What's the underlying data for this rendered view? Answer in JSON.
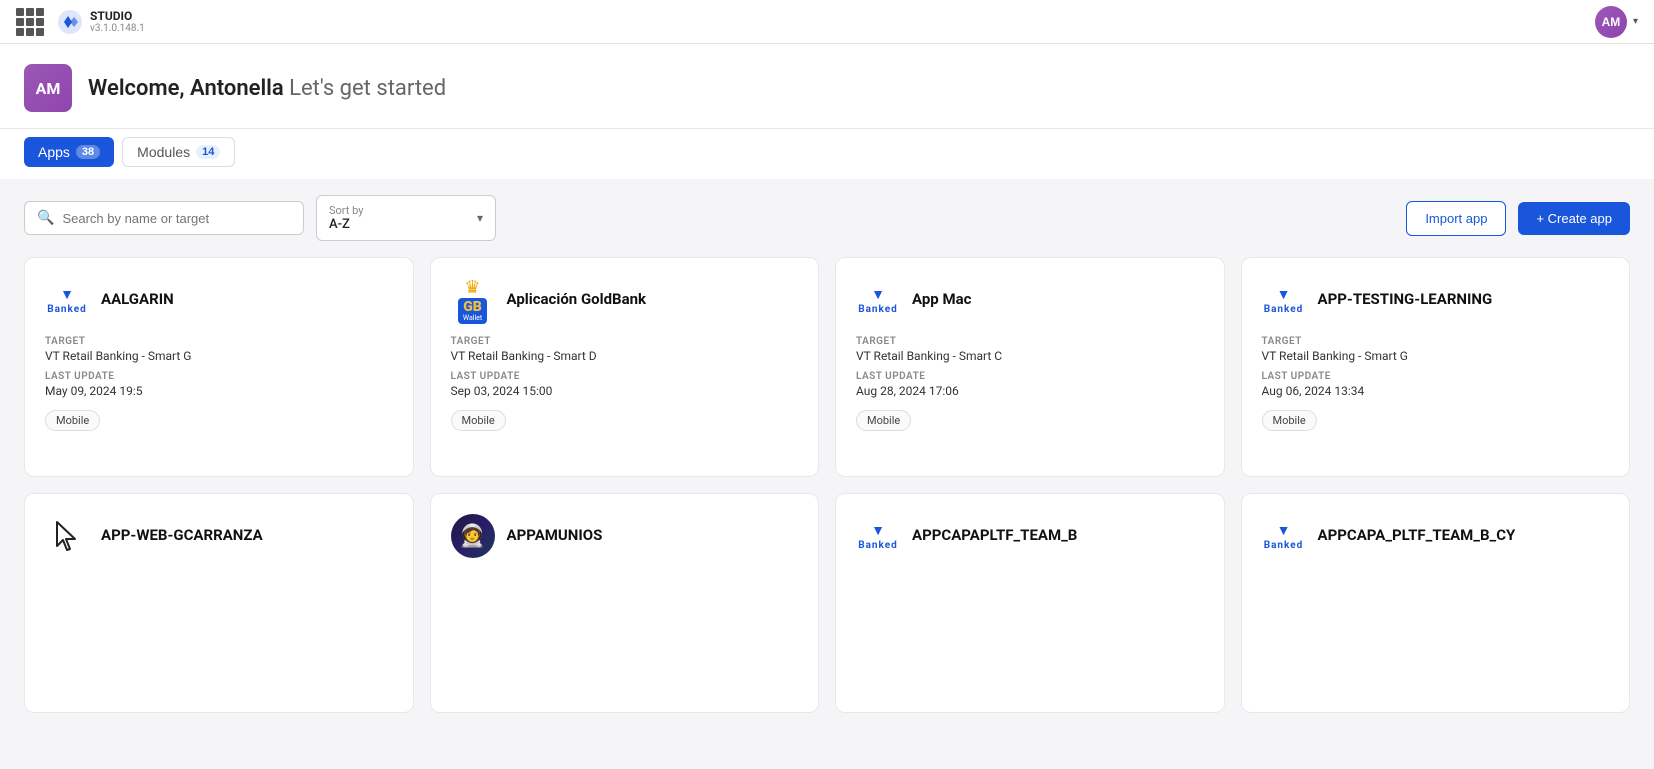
{
  "topNav": {
    "logo": "STUDIO",
    "version": "v3.1.0.148.1",
    "userInitials": "AM"
  },
  "welcome": {
    "userInitials": "AM",
    "greeting": "Welcome, Antonella",
    "subtitle": "Let's get started"
  },
  "tabs": [
    {
      "id": "apps",
      "label": "Apps",
      "count": "38",
      "active": true
    },
    {
      "id": "modules",
      "label": "Modules",
      "count": "14",
      "active": false
    }
  ],
  "toolbar": {
    "searchPlaceholder": "Search by name or target",
    "sortLabel": "Sort by",
    "sortValue": "A-Z",
    "importLabel": "Import app",
    "createLabel": "+ Create app"
  },
  "apps": [
    {
      "id": "aalgarin",
      "name": "AALGARIN",
      "logoType": "banked",
      "target": "VT Retail Banking - Smart G",
      "lastUpdate": "May 09, 2024 19:5",
      "tag": "Mobile"
    },
    {
      "id": "goldbank",
      "name": "Aplicación GoldBank",
      "logoType": "gb",
      "target": "VT Retail Banking - Smart D",
      "lastUpdate": "Sep 03, 2024 15:00",
      "tag": "Mobile"
    },
    {
      "id": "appmac",
      "name": "App Mac",
      "logoType": "banked",
      "target": "VT Retail Banking - Smart C",
      "lastUpdate": "Aug 28, 2024 17:06",
      "tag": "Mobile"
    },
    {
      "id": "apptesting",
      "name": "APP-TESTING-LEARNING",
      "logoType": "banked",
      "target": "VT Retail Banking - Smart G",
      "lastUpdate": "Aug 06, 2024 13:34",
      "tag": "Mobile"
    },
    {
      "id": "appweb",
      "name": "APP-WEB-GCARRANZA",
      "logoType": "cursor",
      "target": "",
      "lastUpdate": "",
      "tag": ""
    },
    {
      "id": "appamunios",
      "name": "APPAMUNIOS",
      "logoType": "astro",
      "target": "",
      "lastUpdate": "",
      "tag": ""
    },
    {
      "id": "appcapapltf",
      "name": "APPCAPAPLTF_TEAM_B",
      "logoType": "banked",
      "target": "",
      "lastUpdate": "",
      "tag": ""
    },
    {
      "id": "appcapapltfcy",
      "name": "APPCAPA_PLTF_TEAM_B_CY",
      "logoType": "banked",
      "target": "",
      "lastUpdate": "",
      "tag": ""
    }
  ],
  "fieldLabels": {
    "target": "TARGET",
    "lastUpdate": "LAST UPDATE"
  }
}
